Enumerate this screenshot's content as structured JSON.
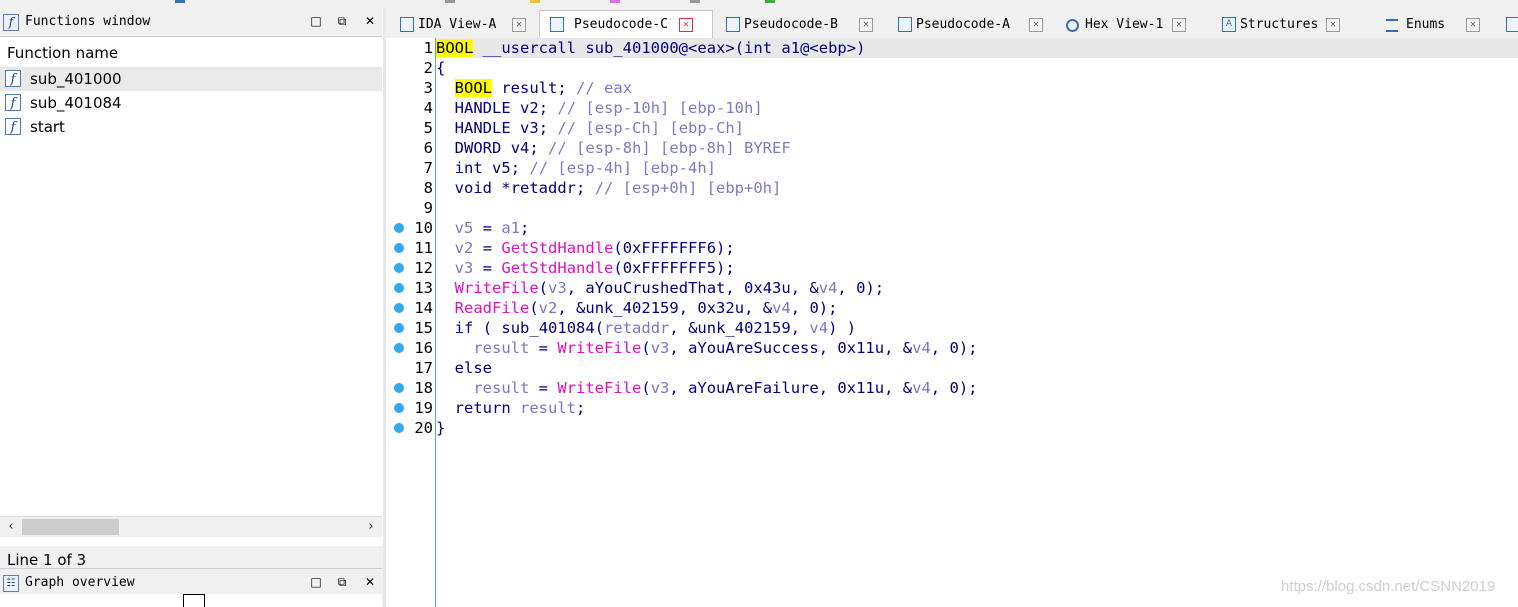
{
  "functions_window": {
    "title": "Functions window",
    "column_header": "Function name",
    "items": [
      {
        "name": "sub_401000"
      },
      {
        "name": "sub_401084"
      },
      {
        "name": "start"
      }
    ],
    "status": "Line 1 of 3"
  },
  "graph_overview": {
    "title": "Graph overview"
  },
  "window_buttons": {
    "restore": "□",
    "float": "🗗",
    "close": "✕"
  },
  "tabs": [
    {
      "label": "IDA View-A",
      "icon": "ida-view-icon"
    },
    {
      "label": "Pseudocode-C",
      "icon": "pseudocode-icon",
      "active": true
    },
    {
      "label": "Pseudocode-B",
      "icon": "pseudocode-icon"
    },
    {
      "label": "Pseudocode-A",
      "icon": "pseudocode-icon"
    },
    {
      "label": "Hex View-1",
      "icon": "hex-view-icon"
    },
    {
      "label": "Structures",
      "icon": "structures-icon"
    },
    {
      "label": "Enums",
      "icon": "enums-icon"
    }
  ],
  "code": {
    "line_numbers": [
      "1",
      "2",
      "3",
      "4",
      "5",
      "6",
      "7",
      "8",
      "9",
      "10",
      "11",
      "12",
      "13",
      "14",
      "15",
      "16",
      "17",
      "18",
      "19",
      "20"
    ],
    "breakpoint_lines": [
      10,
      11,
      12,
      13,
      14,
      15,
      16,
      18,
      19,
      20
    ],
    "lines": [
      "BOOL __usercall sub_401000@<eax>(int a1@<ebp>)",
      "{",
      "  BOOL result; // eax",
      "  HANDLE v2; // [esp-10h] [ebp-10h]",
      "  HANDLE v3; // [esp-Ch] [ebp-Ch]",
      "  DWORD v4; // [esp-8h] [ebp-8h] BYREF",
      "  int v5; // [esp-4h] [ebp-4h]",
      "  void *retaddr; // [esp+0h] [ebp+0h]",
      "",
      "  v5 = a1;",
      "  v2 = GetStdHandle(0xFFFFFFF6);",
      "  v3 = GetStdHandle(0xFFFFFFF5);",
      "  WriteFile(v3, aYouCrushedThat, 0x43u, &v4, 0);",
      "  ReadFile(v2, &unk_402159, 0x32u, &v4, 0);",
      "  if ( sub_401084(retaddr, &unk_402159, v4) )",
      "    result = WriteFile(v3, aYouAreSuccess, 0x11u, &v4, 0);",
      "  else",
      "    result = WriteFile(v3, aYouAreFailure, 0x11u, &v4, 0);",
      "  return result;",
      "}"
    ]
  },
  "watermark": "https://blog.csdn.net/CSNN2019",
  "colors": {
    "keyword": "#000080",
    "variable": "#7878c8",
    "comment": "#7c7cc4",
    "function_call": "#e010c8",
    "highlight": "#ffff00",
    "breakpoint": "#33a8f0"
  }
}
